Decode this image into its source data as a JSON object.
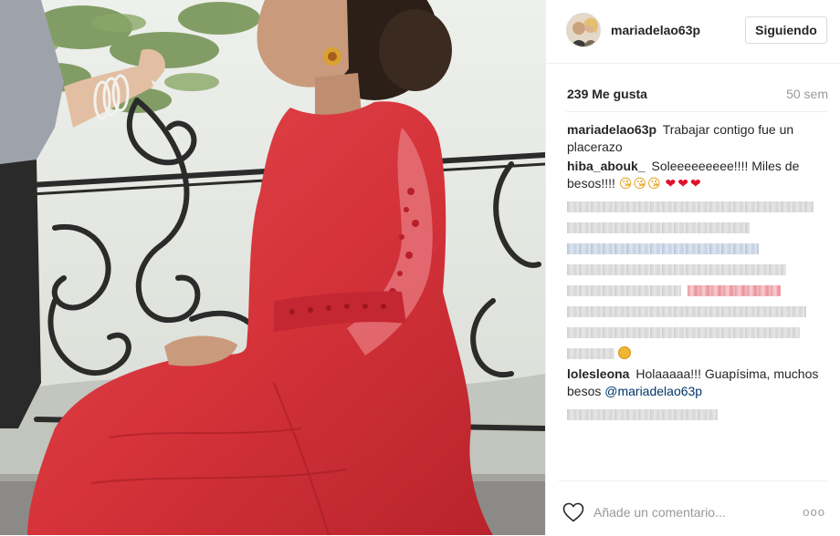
{
  "post": {
    "photo_alt": "",
    "author": {
      "username": "mariadelao63p",
      "follow_label": "Siguiendo"
    },
    "likes": "239 Me gusta",
    "time_ago": "50 sem",
    "comments": [
      {
        "user": "mariadelao63p",
        "text": "Trabajar contigo fue un placerazo"
      },
      {
        "user": "hiba_abouk_",
        "text": "Soleeeeeeeee!!!! Miles de besos!!!!",
        "emoji_faces": "😘😘😘",
        "emoji_hearts": "❤❤❤"
      },
      {
        "user": "lolesleona",
        "text": "Holaaaaa!!! Guapísima, muchos besos",
        "mention": "@mariadelao63p"
      }
    ],
    "comment_box": {
      "placeholder": "Añade un comentario...",
      "more_label": "ooo"
    }
  },
  "icons": {
    "like": "heart-outline-icon",
    "more": "more-options-icon"
  },
  "colors": {
    "text": "#262626",
    "muted": "#999999",
    "border": "#dbdbdb",
    "mention": "#003569",
    "heart": "#e0112b",
    "dress": "#d9323a"
  }
}
